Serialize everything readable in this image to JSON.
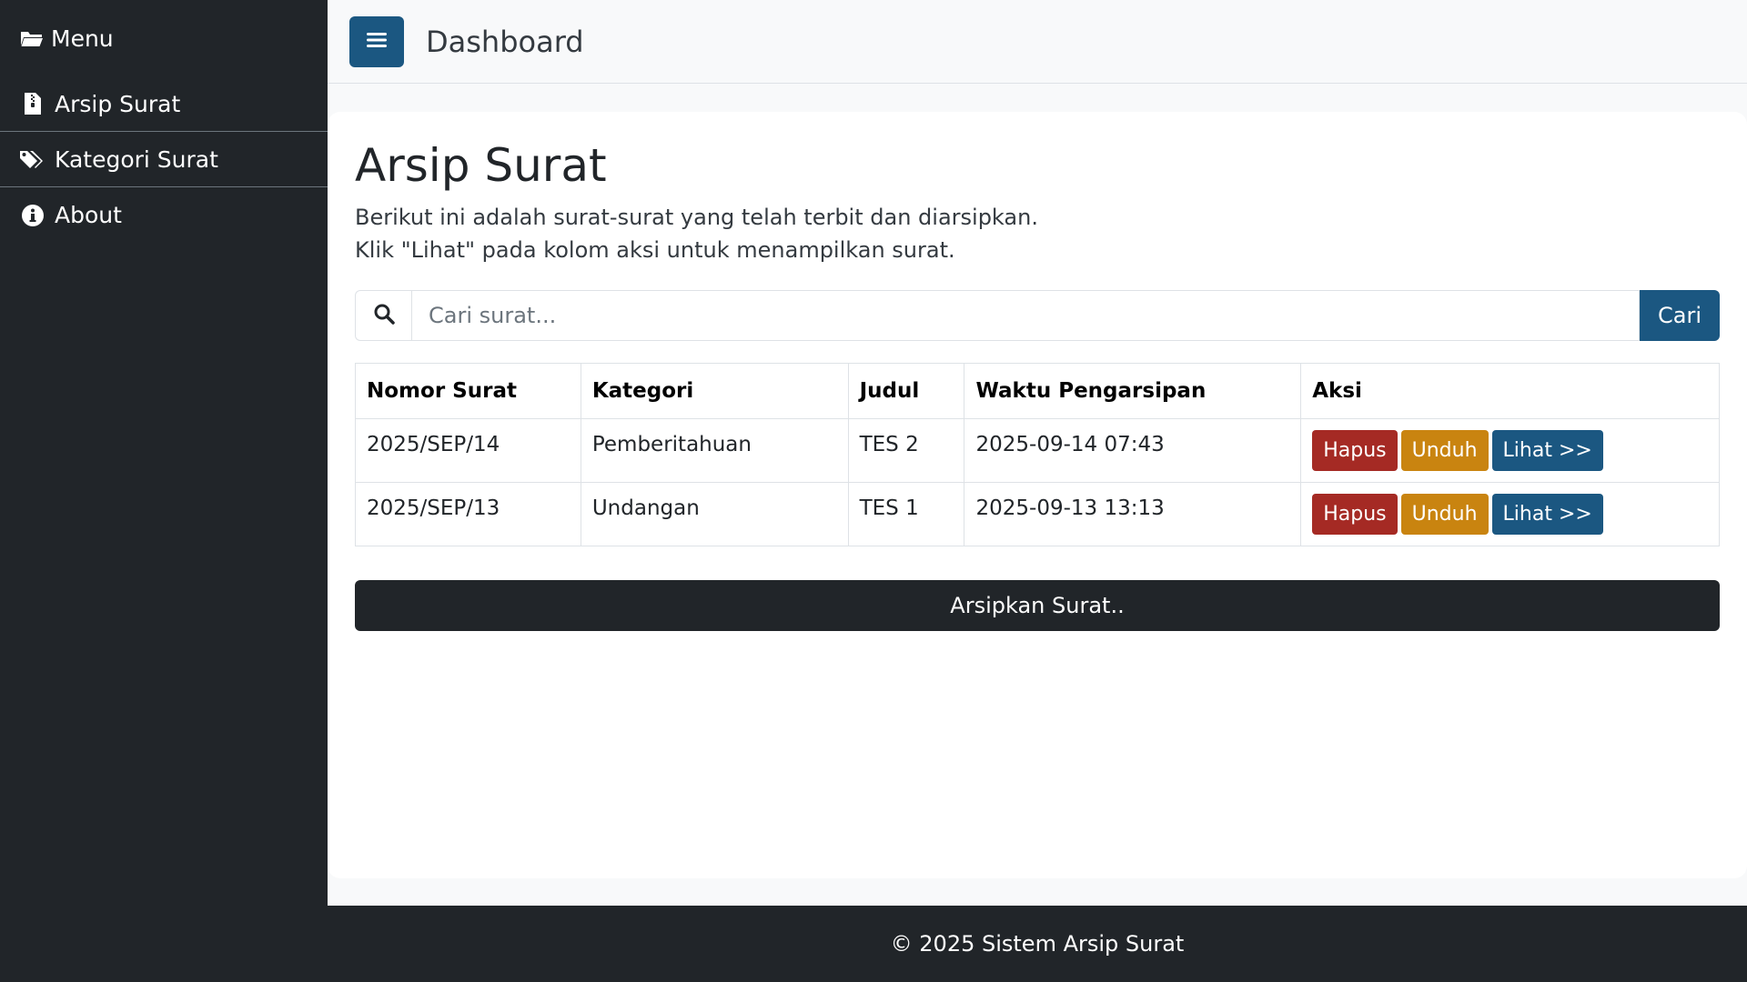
{
  "sidebar": {
    "header": {
      "label": "Menu",
      "icon": "folder-open-icon"
    },
    "items": [
      {
        "label": "Arsip Surat",
        "icon": "file-icon"
      },
      {
        "label": "Kategori Surat",
        "icon": "tags-icon"
      },
      {
        "label": "About",
        "icon": "info-icon"
      }
    ]
  },
  "topbar": {
    "title": "Dashboard",
    "toggle_icon": "hamburger-icon"
  },
  "main": {
    "title": "Arsip Surat",
    "description_line1": "Berikut ini adalah surat-surat yang telah terbit dan diarsipkan.",
    "description_line2": "Klik \"Lihat\" pada kolom aksi untuk menampilkan surat.",
    "search": {
      "placeholder": "Cari surat...",
      "value": "",
      "button_label": "Cari",
      "icon": "search-icon"
    },
    "table": {
      "headers": [
        "Nomor Surat",
        "Kategori",
        "Judul",
        "Waktu Pengarsipan",
        "Aksi"
      ],
      "rows": [
        {
          "nomor": "2025/SEP/14",
          "kategori": "Pemberitahuan",
          "judul": "TES 2",
          "waktu": "2025-09-14 07:43"
        },
        {
          "nomor": "2025/SEP/13",
          "kategori": "Undangan",
          "judul": "TES 1",
          "waktu": "2025-09-13 13:13"
        }
      ],
      "actions": {
        "delete_label": "Hapus",
        "download_label": "Unduh",
        "view_label": "Lihat >>"
      }
    },
    "archive_button_label": "Arsipkan Surat.."
  },
  "footer": {
    "text": "© 2025 Sistem Arsip Surat"
  },
  "colors": {
    "sidebar_bg": "#212529",
    "primary": "#1b5781",
    "danger": "#a52a24",
    "warning": "#c98410",
    "page_bg": "#f8f9fa"
  }
}
